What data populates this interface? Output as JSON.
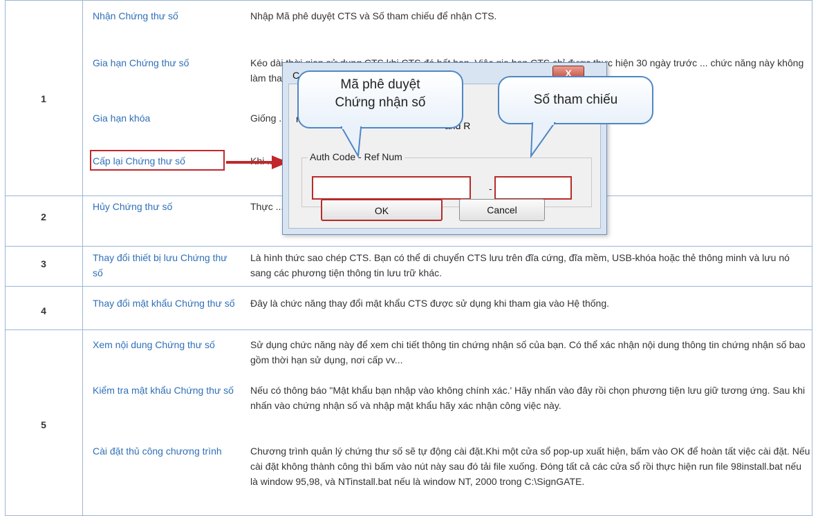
{
  "rows": [
    {
      "number": "1",
      "items": [
        {
          "link": "Nhận Chứng thư số",
          "desc": "Nhập Mã phê duyệt CTS và Số tham chiếu để nhận CTS."
        },
        {
          "link": "Gia hạn Chứng thư số",
          "desc": "Kéo dài thời gian sử dụng CTS khi CTS đó hết hạn. Việc gia hạn CTS chỉ được thực hiện 30 ngày trước ... chức năng này không làm thay đổi ..."
        },
        {
          "link": "Gia hạn khóa",
          "desc": "Giống ... đang dùng."
        },
        {
          "link": "Cấp lại Chứng thư số",
          "desc": "Khi ... nhận số và theo các bước như đăng ..."
        }
      ]
    },
    {
      "number": "2",
      "items": [
        {
          "link": "Hủy Chứng thư số",
          "desc": "Thực ... tất cả thông tin liên quan đến CTS này s..."
        }
      ]
    },
    {
      "number": "3",
      "items": [
        {
          "link": "Thay đổi thiết bị lưu Chứng thư số",
          "desc": "Là hình thức sao chép CTS. Bạn có thể di chuyển CTS lưu trên đĩa cứng, đĩa mềm, USB-khóa hoặc thẻ thông minh và lưu nó sang các phương tiện thông tin lưu trữ khác."
        }
      ]
    },
    {
      "number": "4",
      "items": [
        {
          "link": "Thay đổi mật khẩu Chứng thư số",
          "desc": "Đây là chức năng thay đổi mật khẩu CTS được sử dụng khi tham gia vào Hệ thống."
        }
      ]
    },
    {
      "number": "5",
      "items": [
        {
          "link": "Xem nội dung Chứng thư số",
          "desc": "Sử dụng chức năng này để xem chi tiết thông tin chứng nhận số của bạn. Có thể xác nhận nội dung thông tin chứng nhận số bao gồm thời hạn sử dụng, nơi cấp vv..."
        },
        {
          "link": "Kiểm tra mật khẩu Chứng thư số",
          "desc": "Nếu có thông báo \"Mật khẩu bạn nhập vào không chính xác.' Hãy nhấn vào đây rồi chọn phương tiện lưu giữ tương ứng. Sau khi nhấn vào chứng nhận số và nhập mật khẩu hãy xác nhận công việc này."
        },
        {
          "link": "Cài đặt thủ công chương trình",
          "desc": "Chương trình quản lý chứng thư số sẽ tự động cài đặt.Khi một cửa sổ pop-up xuất hiện, bấm vào OK để hoàn tất việc cài đặt. Nếu cài đặt không thành công thì bấm vào nút này sau đó tải file xuống. Đóng tất cả các cửa sổ rồi thực hiện run file 98install.bat nếu là window 95,98, và NTinstall.bat nếu là window NT, 2000 trong C:\\SignGATE."
        }
      ]
    }
  ],
  "dialog": {
    "title": "C",
    "close_label": "X",
    "body_text_1": "numbe",
    "body_text_2": "and R",
    "group_label": "Auth Code - Ref Num",
    "separator": "-",
    "ok_label": "OK",
    "cancel_label": "Cancel"
  },
  "callouts": {
    "auth_code": "Mã phê duyệt Chứng nhận số",
    "ref_num": "Số tham chiếu"
  },
  "colors": {
    "link": "#2f6fb8",
    "highlight": "#c0282d",
    "grid": "#9bb6d6",
    "callout_border": "#4e86c4"
  }
}
